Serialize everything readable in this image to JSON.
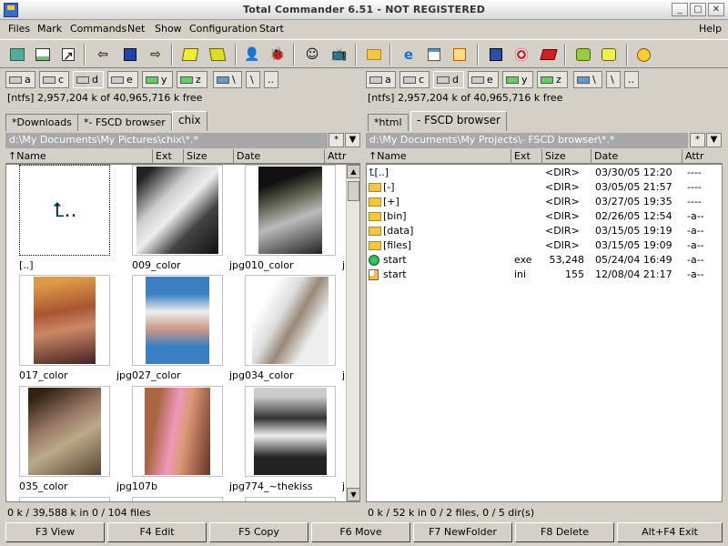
{
  "window": {
    "title": "Total Commander 6.51 - NOT REGISTERED"
  },
  "menu": [
    "Files",
    "Mark",
    "Commands",
    "Net",
    "Show",
    "Configuration",
    "Start"
  ],
  "menu_help": "Help",
  "toolbar_icons": [
    "reread-icon",
    "brief-view-icon",
    "full-view-icon",
    "back-icon",
    "save-icon",
    "forward-icon",
    "pack-icon",
    "unpack-icon",
    "person-icon",
    "bug-icon",
    "user-icon",
    "tv-icon",
    "folder-open-icon",
    "ie-icon",
    "notepad-icon",
    "notepad-color-icon",
    "disk-icon",
    "target-icon",
    "book-icon",
    "green-arrow-icon",
    "yellow-arrow-icon",
    "smiley-icon"
  ],
  "left": {
    "drives": [
      "a",
      "c",
      "d",
      "e",
      "y",
      "z",
      "\\",
      ".."
    ],
    "free": "[ntfs]  2,957,204 k of 40,965,716 k free",
    "tabs": [
      "*Downloads",
      "*- FSCD browser",
      "chix"
    ],
    "path": "d:\\My Documents\\My Pictures\\chix\\*.*",
    "columns": [
      "↑Name",
      "Ext",
      "Size",
      "Date",
      "Attr"
    ],
    "thumbs": [
      {
        "name": "[..]",
        "ext": ""
      },
      {
        "name": "009_color",
        "ext": "jpg"
      },
      {
        "name": "010_color",
        "ext": "jpg"
      },
      {
        "name": "017_color",
        "ext": "jpg"
      },
      {
        "name": "027_color",
        "ext": "jpg"
      },
      {
        "name": "034_color",
        "ext": "jpg"
      },
      {
        "name": "035_color",
        "ext": "jpg"
      },
      {
        "name": "107b",
        "ext": "jpg"
      },
      {
        "name": "774_~thekiss",
        "ext": "jpg"
      }
    ],
    "status": "0 k / 39,588 k in 0 / 104 files"
  },
  "right": {
    "drives": [
      "a",
      "c",
      "d",
      "e",
      "y",
      "z",
      "\\",
      ".."
    ],
    "free": "[ntfs]  2,957,204 k of 40,965,716 k free",
    "tabs": [
      "*html",
      "- FSCD browser"
    ],
    "path": "d:\\My Documents\\My Projects\\- FSCD browser\\*.*",
    "columns": [
      "↑Name",
      "Ext",
      "Size",
      "Date",
      "Attr"
    ],
    "rows": [
      {
        "name": "[..]",
        "ext": "",
        "size": "<DIR>",
        "date": "03/30/05 12:20",
        "attr": "----",
        "icon": "up-dir-icon"
      },
      {
        "name": "[-]",
        "ext": "",
        "size": "<DIR>",
        "date": "03/05/05 21:57",
        "attr": "----",
        "icon": "folder-icon"
      },
      {
        "name": "[+]",
        "ext": "",
        "size": "<DIR>",
        "date": "03/27/05 19:35",
        "attr": "----",
        "icon": "folder-icon"
      },
      {
        "name": "[bin]",
        "ext": "",
        "size": "<DIR>",
        "date": "02/26/05 12:54",
        "attr": "-a--",
        "icon": "folder-icon"
      },
      {
        "name": "[data]",
        "ext": "",
        "size": "<DIR>",
        "date": "03/15/05 19:19",
        "attr": "-a--",
        "icon": "folder-icon"
      },
      {
        "name": "[files]",
        "ext": "",
        "size": "<DIR>",
        "date": "03/15/05 19:09",
        "attr": "-a--",
        "icon": "folder-icon"
      },
      {
        "name": "start",
        "ext": "exe",
        "size": "53,248",
        "date": "05/24/04 16:49",
        "attr": "-a--",
        "icon": "exe-icon"
      },
      {
        "name": "start",
        "ext": "ini",
        "size": "155",
        "date": "12/08/04 21:17",
        "attr": "-a--",
        "icon": "ini-icon"
      }
    ],
    "status": "0 k / 52 k in 0 / 2 files, 0 / 5 dir(s)"
  },
  "fkeys": [
    "F3 View",
    "F4 Edit",
    "F5 Copy",
    "F6 Move",
    "F7 NewFolder",
    "F8 Delete",
    "Alt+F4 Exit"
  ],
  "path_buttons": {
    "star": "*",
    "dropdown": "▼"
  }
}
